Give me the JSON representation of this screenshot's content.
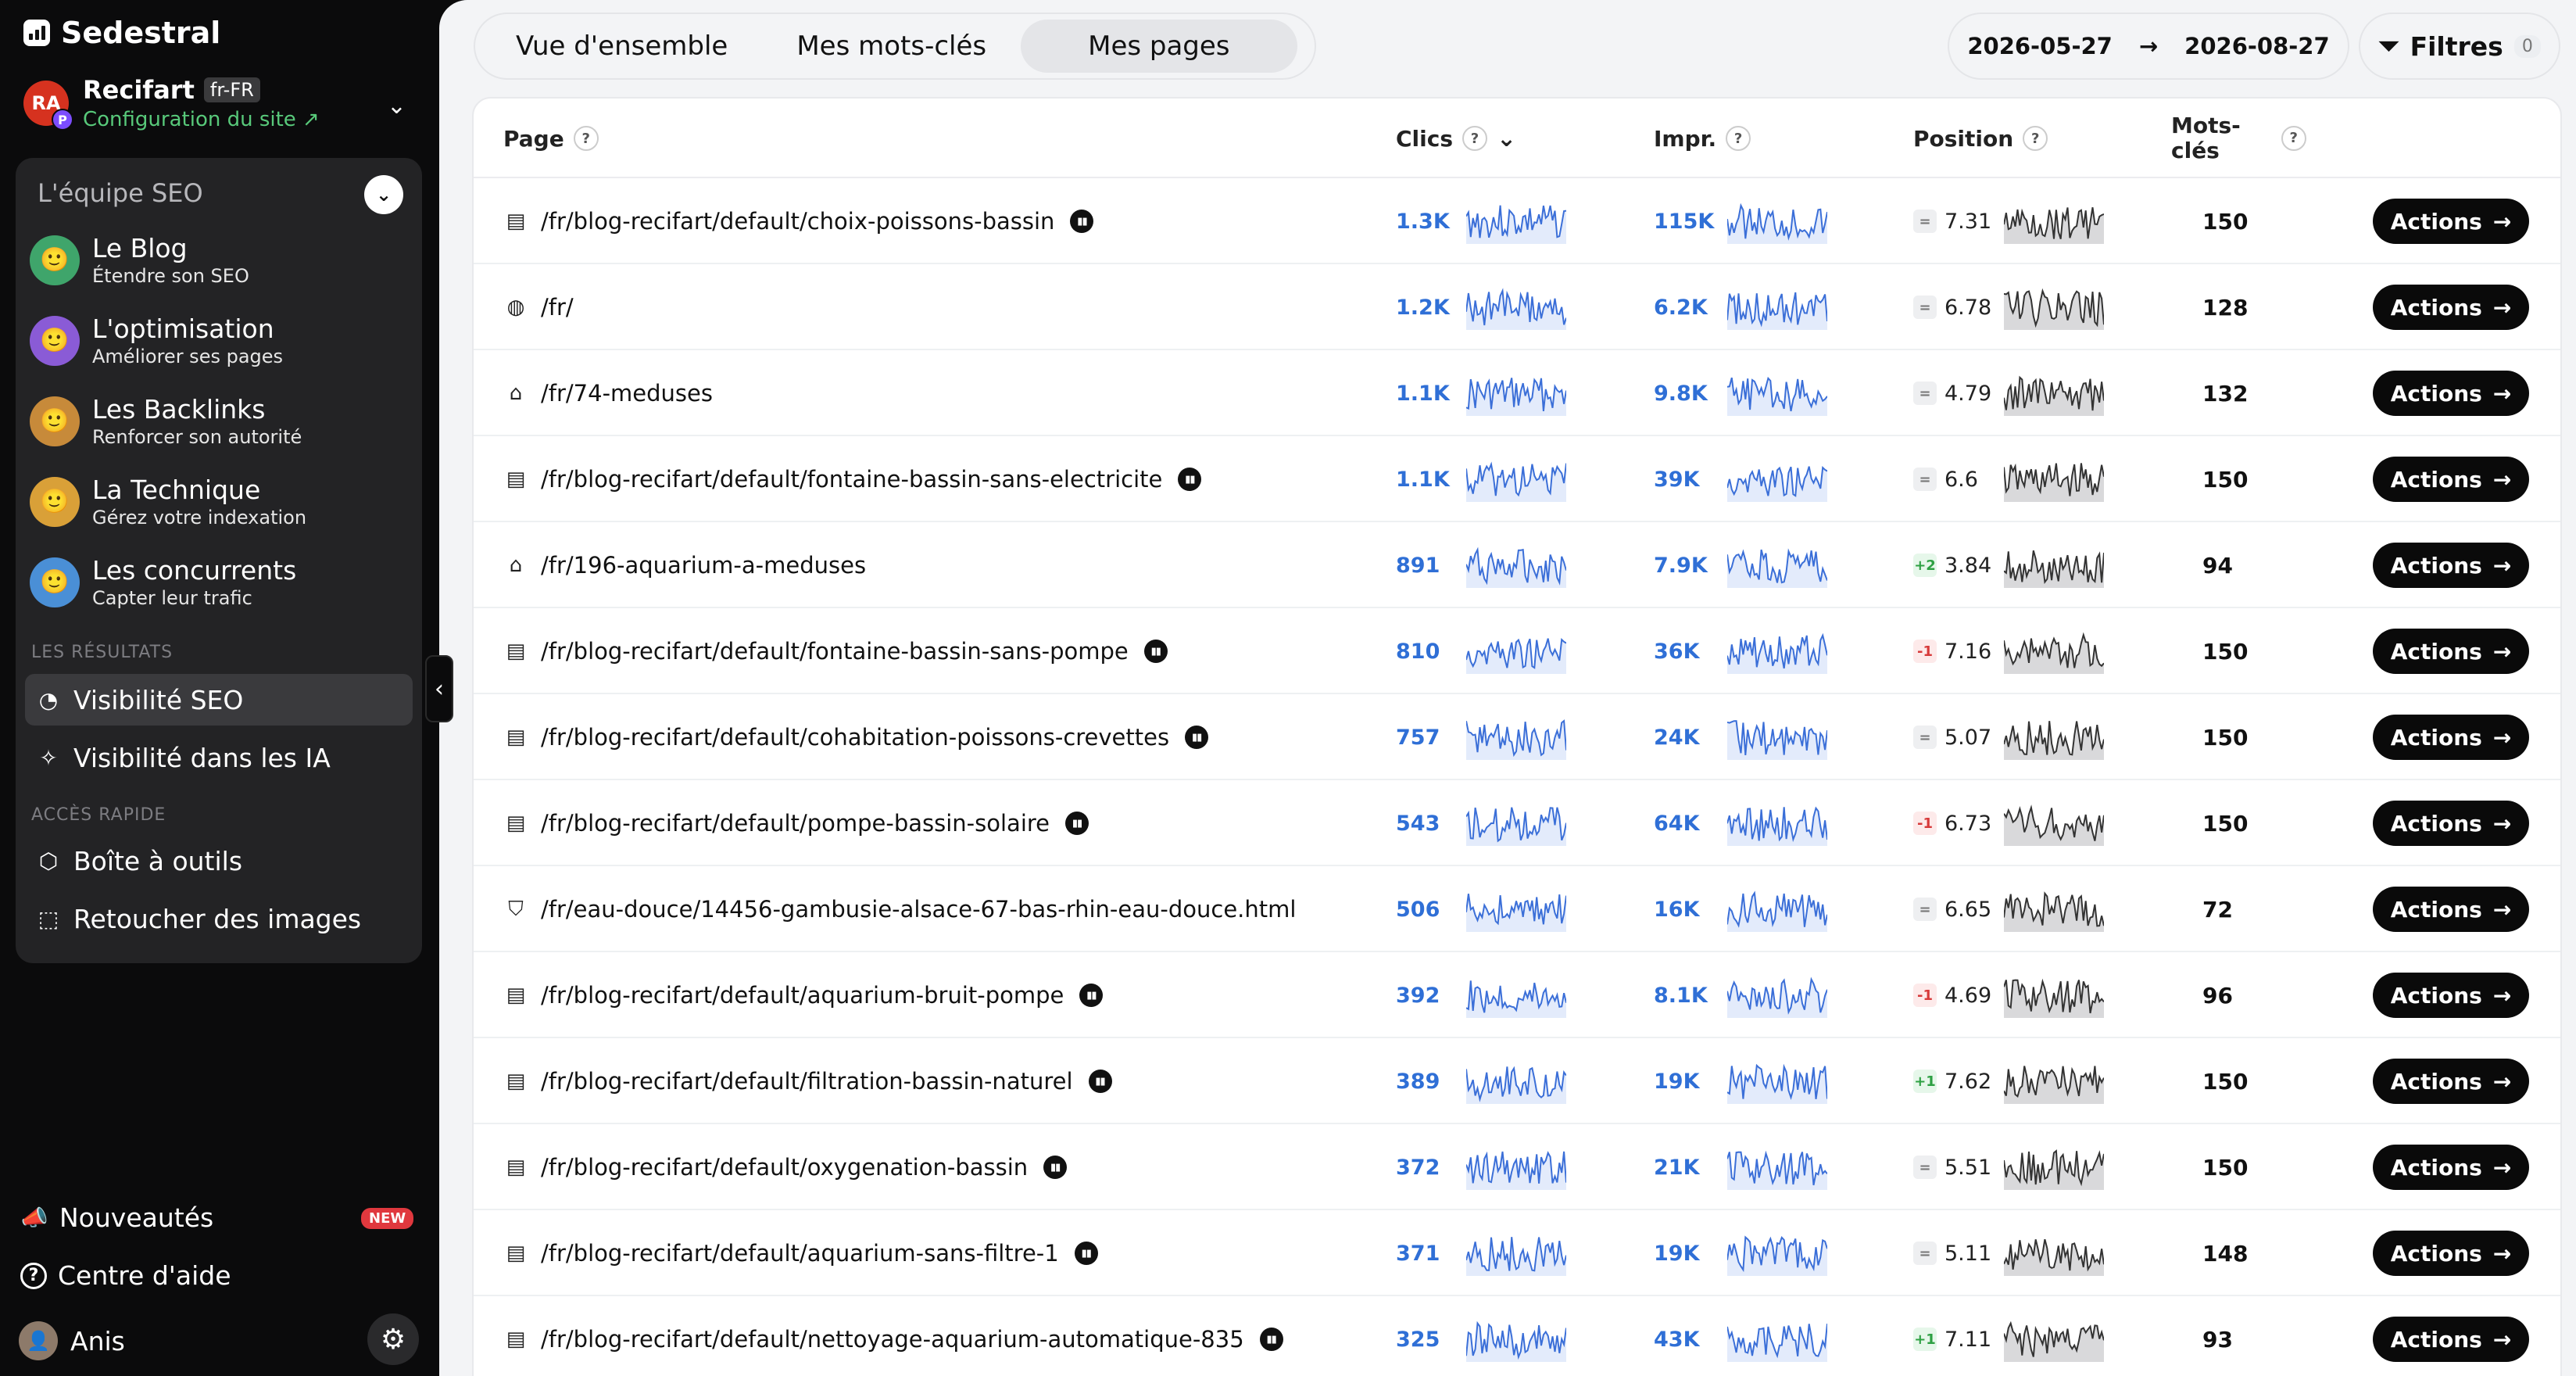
{
  "sidebar": {
    "brand": "Sedestral",
    "site": {
      "avatar": "RA",
      "avatar_sub": "P",
      "name": "Recifart",
      "lang": "fr-FR",
      "config_link": "Configuration du site ↗"
    },
    "team_header": "L'équipe SEO",
    "agents": [
      {
        "title": "Le Blog",
        "subtitle": "Étendre son SEO",
        "color": "#3fa56b",
        "icon": "🙂"
      },
      {
        "title": "L'optimisation",
        "subtitle": "Améliorer ses pages",
        "color": "#8a5bd6",
        "icon": "🙂"
      },
      {
        "title": "Les Backlinks",
        "subtitle": "Renforcer son autorité",
        "color": "#c78a3a",
        "icon": "🙂"
      },
      {
        "title": "La Technique",
        "subtitle": "Gérez votre indexation",
        "color": "#d9a038",
        "icon": "🙂"
      },
      {
        "title": "Les concurrents",
        "subtitle": "Capter leur trafic",
        "color": "#4a8fd6",
        "icon": "🙂"
      }
    ],
    "results_label": "LES RÉSULTATS",
    "results": [
      {
        "label": "Visibilité SEO",
        "icon": "◔"
      },
      {
        "label": "Visibilité dans les IA",
        "icon": "✧"
      }
    ],
    "quick_label": "ACCÈS RAPIDE",
    "quick": [
      {
        "label": "Boîte à outils",
        "icon": "⬡"
      },
      {
        "label": "Retoucher des images",
        "icon": "⬚"
      }
    ],
    "news_label": "Nouveautés",
    "news_badge": "NEW",
    "help_label": "Centre d'aide",
    "user_name": "Anis"
  },
  "topbar": {
    "tabs": [
      "Vue d'ensemble",
      "Mes mots-clés",
      "Mes pages"
    ],
    "active_tab": 2,
    "date_from": "2026-05-27",
    "date_to": "2026-08-27",
    "filters_label": "Filtres",
    "filters_count": "0"
  },
  "table": {
    "headers": {
      "page": "Page",
      "clicks": "Clics",
      "impr": "Impr.",
      "position": "Position",
      "keywords": "Mots-\nclés"
    },
    "help_mark": "?",
    "action_label": "Actions",
    "rows": [
      {
        "icon": "doc",
        "url": "/fr/blog-recifart/default/choix-poissons-bassin",
        "badge": true,
        "clicks": "1.3K",
        "impr": "115K",
        "pos_change": "=",
        "position": "7.31",
        "keywords": "150"
      },
      {
        "icon": "globe",
        "url": "/fr/",
        "badge": false,
        "clicks": "1.2K",
        "impr": "6.2K",
        "pos_change": "=",
        "position": "6.78",
        "keywords": "128"
      },
      {
        "icon": "store",
        "url": "/fr/74-meduses",
        "badge": false,
        "clicks": "1.1K",
        "impr": "9.8K",
        "pos_change": "=",
        "position": "4.79",
        "keywords": "132"
      },
      {
        "icon": "doc",
        "url": "/fr/blog-recifart/default/fontaine-bassin-sans-electricite",
        "badge": true,
        "clicks": "1.1K",
        "impr": "39K",
        "pos_change": "=",
        "position": "6.6",
        "keywords": "150"
      },
      {
        "icon": "store",
        "url": "/fr/196-aquarium-a-meduses",
        "badge": false,
        "clicks": "891",
        "impr": "7.9K",
        "pos_change": "+2",
        "position": "3.84",
        "keywords": "94"
      },
      {
        "icon": "doc",
        "url": "/fr/blog-recifart/default/fontaine-bassin-sans-pompe",
        "badge": true,
        "clicks": "810",
        "impr": "36K",
        "pos_change": "-1",
        "position": "7.16",
        "keywords": "150"
      },
      {
        "icon": "doc",
        "url": "/fr/blog-recifart/default/cohabitation-poissons-crevettes",
        "badge": true,
        "clicks": "757",
        "impr": "24K",
        "pos_change": "=",
        "position": "5.07",
        "keywords": "150"
      },
      {
        "icon": "doc",
        "url": "/fr/blog-recifart/default/pompe-bassin-solaire",
        "badge": true,
        "clicks": "543",
        "impr": "64K",
        "pos_change": "-1",
        "position": "6.73",
        "keywords": "150"
      },
      {
        "icon": "bag",
        "url": "/fr/eau-douce/14456-gambusie-alsace-67-bas-rhin-eau-douce.html",
        "badge": false,
        "clicks": "506",
        "impr": "16K",
        "pos_change": "=",
        "position": "6.65",
        "keywords": "72"
      },
      {
        "icon": "doc",
        "url": "/fr/blog-recifart/default/aquarium-bruit-pompe",
        "badge": true,
        "clicks": "392",
        "impr": "8.1K",
        "pos_change": "-1",
        "position": "4.69",
        "keywords": "96"
      },
      {
        "icon": "doc",
        "url": "/fr/blog-recifart/default/filtration-bassin-naturel",
        "badge": true,
        "clicks": "389",
        "impr": "19K",
        "pos_change": "+1",
        "position": "7.62",
        "keywords": "150"
      },
      {
        "icon": "doc",
        "url": "/fr/blog-recifart/default/oxygenation-bassin",
        "badge": true,
        "clicks": "372",
        "impr": "21K",
        "pos_change": "=",
        "position": "5.51",
        "keywords": "150"
      },
      {
        "icon": "doc",
        "url": "/fr/blog-recifart/default/aquarium-sans-filtre-1",
        "badge": true,
        "clicks": "371",
        "impr": "19K",
        "pos_change": "=",
        "position": "5.11",
        "keywords": "148"
      },
      {
        "icon": "doc",
        "url": "/fr/blog-recifart/default/nettoyage-aquarium-automatique-835",
        "badge": true,
        "clicks": "325",
        "impr": "43K",
        "pos_change": "+1",
        "position": "7.11",
        "keywords": "93"
      }
    ]
  },
  "colors": {
    "accent_blue": "#2f6fd6",
    "spark_blue": "#3b6fd8",
    "spark_gray": "#333333",
    "up": "#2ea043",
    "down": "#d73a3a"
  }
}
